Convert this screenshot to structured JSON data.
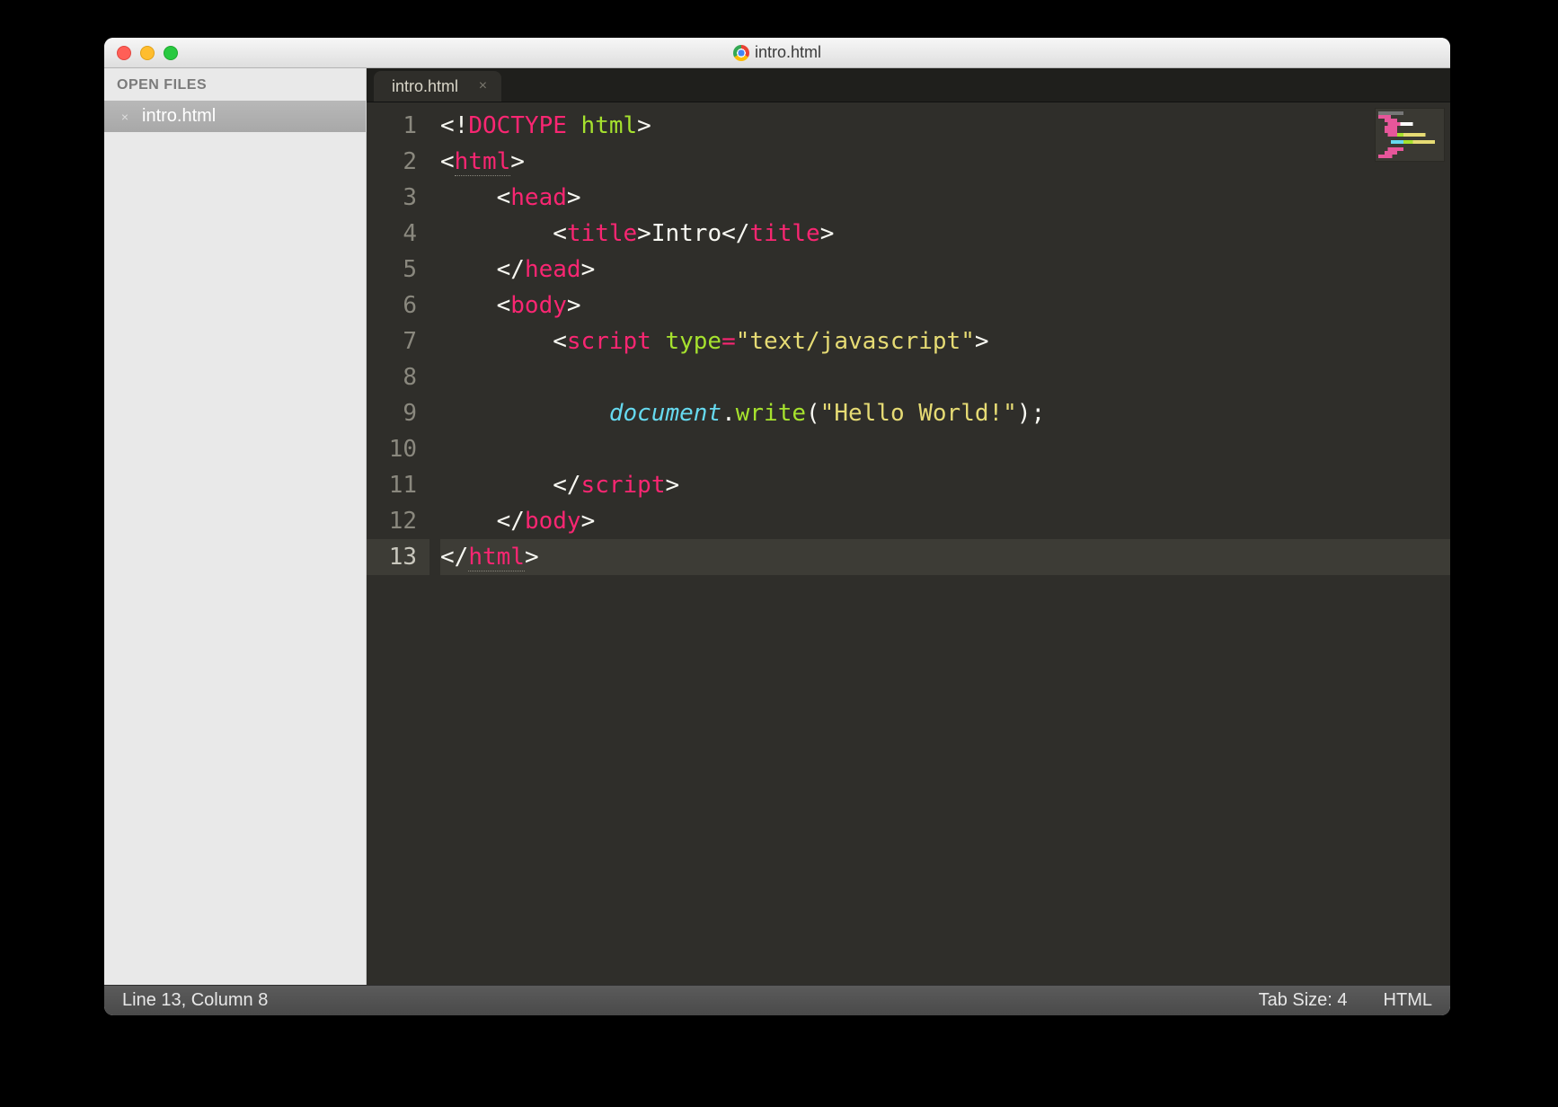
{
  "window": {
    "title": "intro.html"
  },
  "sidebar": {
    "header": "OPEN FILES",
    "items": [
      {
        "label": "intro.html"
      }
    ]
  },
  "tabs": [
    {
      "label": "intro.html",
      "active": true
    }
  ],
  "editor": {
    "current_line": 13,
    "lines": [
      {
        "n": 1,
        "tokens": [
          [
            "p",
            "<!"
          ],
          [
            "tag",
            "DOCTYPE"
          ],
          [
            "p",
            " "
          ],
          [
            "attr",
            "html"
          ],
          [
            "p",
            ">"
          ]
        ]
      },
      {
        "n": 2,
        "tokens": [
          [
            "p",
            "<"
          ],
          [
            "tag",
            "html",
            true
          ],
          [
            "p",
            ">"
          ]
        ]
      },
      {
        "n": 3,
        "tokens": [
          [
            "p",
            "    "
          ],
          [
            "p",
            "<"
          ],
          [
            "tag",
            "head"
          ],
          [
            "p",
            ">"
          ]
        ]
      },
      {
        "n": 4,
        "tokens": [
          [
            "p",
            "        "
          ],
          [
            "p",
            "<"
          ],
          [
            "tag",
            "title"
          ],
          [
            "p",
            ">"
          ],
          [
            "txt",
            "Intro"
          ],
          [
            "p",
            "</"
          ],
          [
            "tag",
            "title"
          ],
          [
            "p",
            ">"
          ]
        ]
      },
      {
        "n": 5,
        "tokens": [
          [
            "p",
            "    "
          ],
          [
            "p",
            "</"
          ],
          [
            "tag",
            "head"
          ],
          [
            "p",
            ">"
          ]
        ]
      },
      {
        "n": 6,
        "tokens": [
          [
            "p",
            "    "
          ],
          [
            "p",
            "<"
          ],
          [
            "tag",
            "body"
          ],
          [
            "p",
            ">"
          ]
        ]
      },
      {
        "n": 7,
        "tokens": [
          [
            "p",
            "        "
          ],
          [
            "p",
            "<"
          ],
          [
            "tag",
            "script"
          ],
          [
            "p",
            " "
          ],
          [
            "attr",
            "type"
          ],
          [
            "tag",
            "="
          ],
          [
            "str",
            "\"text/javascript\""
          ],
          [
            "p",
            ">"
          ]
        ]
      },
      {
        "n": 8,
        "tokens": []
      },
      {
        "n": 9,
        "tokens": [
          [
            "p",
            "            "
          ],
          [
            "obj",
            "document"
          ],
          [
            "p",
            "."
          ],
          [
            "fn",
            "write"
          ],
          [
            "p",
            "("
          ],
          [
            "str",
            "\"Hello World!\""
          ],
          [
            "p",
            ")"
          ],
          [
            "p",
            ";"
          ]
        ]
      },
      {
        "n": 10,
        "tokens": []
      },
      {
        "n": 11,
        "tokens": [
          [
            "p",
            "        "
          ],
          [
            "p",
            "</"
          ],
          [
            "tag",
            "script"
          ],
          [
            "p",
            ">"
          ]
        ]
      },
      {
        "n": 12,
        "tokens": [
          [
            "p",
            "    "
          ],
          [
            "p",
            "</"
          ],
          [
            "tag",
            "body"
          ],
          [
            "p",
            ">"
          ]
        ]
      },
      {
        "n": 13,
        "tokens": [
          [
            "p",
            "</"
          ],
          [
            "tag",
            "html",
            true
          ],
          [
            "p",
            ">"
          ]
        ]
      }
    ]
  },
  "statusbar": {
    "position": "Line 13, Column 8",
    "tab_size": "Tab Size: 4",
    "syntax": "HTML"
  }
}
